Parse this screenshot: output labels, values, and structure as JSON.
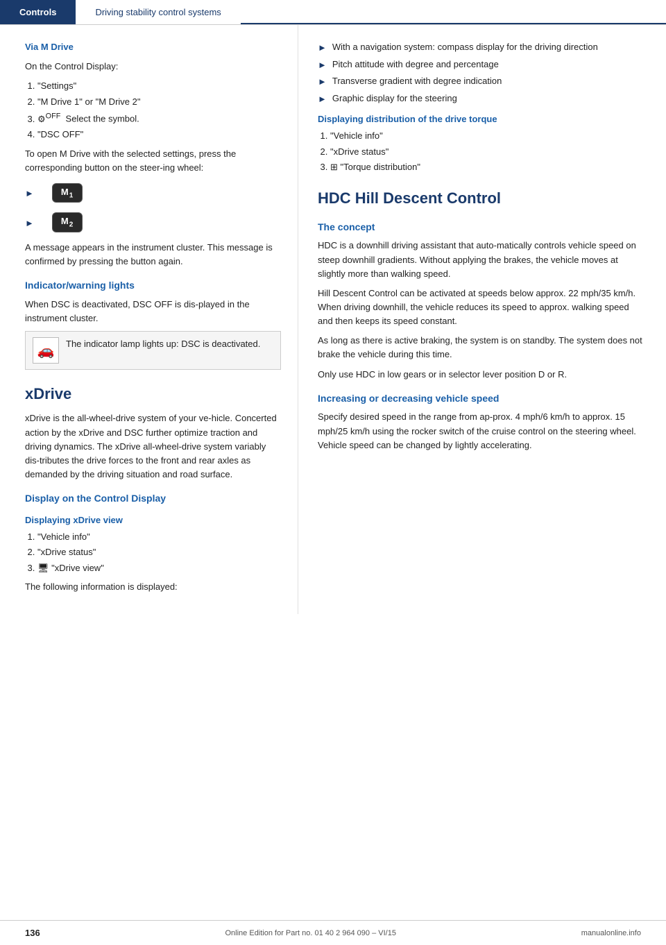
{
  "header": {
    "tab_active": "Controls",
    "tab_inactive": "Driving stability control systems"
  },
  "left": {
    "via_m_drive": {
      "heading": "Via M Drive",
      "intro": "On the Control Display:",
      "steps": [
        "\"Settings\"",
        "\"M Drive 1\" or \"M Drive 2\"",
        "Select the symbol.",
        "\"DSC OFF\""
      ],
      "step3_icon": "⚙",
      "after_steps": "To open M Drive with the selected settings, press the corresponding button on the steer‑ing wheel:",
      "m1_label": "M1",
      "m2_label": "M2",
      "message_text": "A message appears in the instrument cluster. This message is confirmed by pressing the button again."
    },
    "indicator": {
      "heading": "Indicator/warning lights",
      "body": "When DSC is deactivated, DSC OFF is dis‑played in the instrument cluster.",
      "warning_text": "The indicator lamp lights up: DSC is deactivated."
    },
    "xdrive": {
      "heading": "xDrive",
      "body": "xDrive is the all-wheel-drive system of your ve‑hicle. Concerted action by the xDrive and DSC further optimize traction and driving dynamics. The xDrive all-wheel-drive system variably dis‑tributes the drive forces to the front and rear axles as demanded by the driving situation and road surface.",
      "display_heading": "Display on the Control Display",
      "displaying_xdrive_heading": "Displaying xDrive view",
      "xdrive_steps": [
        "\"Vehicle info\"",
        "\"xDrive status\"",
        "\"xDrive view\""
      ],
      "step3_icon": "🖥",
      "following_info": "The following information is displayed:"
    }
  },
  "right": {
    "bullet_items": [
      "With a navigation system: compass display for the driving direction",
      "Pitch attitude with degree and percentage",
      "Transverse gradient with degree indication",
      "Graphic display for the steering"
    ],
    "torque_heading": "Displaying distribution of the drive torque",
    "torque_steps": [
      "\"Vehicle info\"",
      "\"xDrive status\"",
      "\"Torque distribution\""
    ],
    "torque_step3_icon": "⊞",
    "hdc_heading": "HDC Hill Descent Control",
    "concept_heading": "The concept",
    "concept_paragraphs": [
      "HDC is a downhill driving assistant that auto‑matically controls vehicle speed on steep downhill gradients. Without applying the brakes, the vehicle moves at slightly more than walking speed.",
      "Hill Descent Control can be activated at speeds below approx. 22 mph/35 km/h. When driving downhill, the vehicle reduces its speed to approx. walking speed and then keeps its speed constant.",
      "As long as there is active braking, the system is on standby. The system does not brake the vehicle during this time.",
      "Only use HDC in low gears or in selector lever position D or R."
    ],
    "speed_heading": "Increasing or decreasing vehicle speed",
    "speed_body": "Specify desired speed in the range from ap‑prox. 4 mph/6 km/h to approx. 15 mph/25 km/h using the rocker switch of the cruise control on the steering wheel. Vehicle speed can be changed by lightly accelerating."
  },
  "footer": {
    "page_number": "136",
    "info": "Online Edition for Part no. 01 40 2 964 090 – VI/15",
    "site": "manualonline.info"
  }
}
